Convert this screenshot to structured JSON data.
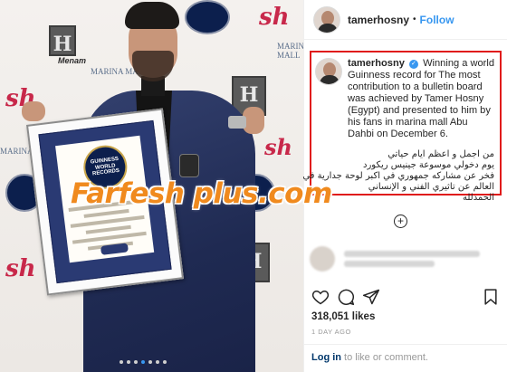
{
  "post": {
    "username": "tamerhosny",
    "separator": "•",
    "follow_label": "Follow",
    "caption_username": "tamerhosny",
    "caption_en": "Winning a world Guinness record for The most contribution to a bulletin board was achieved by Tamer Hosny (Egypt) and presented to him by his fans in marina mall Abu Dahbi on December 6.",
    "caption_ar": [
      "من اجمل و اعظم ايام حياتي",
      "يوم دخولي موسوعة جينيس ريكورد",
      "فخر عن مشاركه جمهوري في اكبر لوحة جدارية في",
      "العالم عن تاثيري الفني و الإنساني",
      "الحمدلله"
    ],
    "likes": "318,051 likes",
    "time_ago": "1 DAY AGO",
    "footer_link": "Log in",
    "footer_rest": " to like or comment."
  },
  "photo": {
    "watermark": "Farfesh plus.com",
    "logos": {
      "sh": "sh",
      "menam": "Menam",
      "marina_mall": "MARINA MALL",
      "world_records": "GUINNESS WORLD RECORDS",
      "cert_seal": "GUINNESS WORLD RECORDS"
    },
    "carousel_dots": 7,
    "active_dot": 3
  },
  "icons": {
    "verified": "verified-badge-icon",
    "heart": "heart-icon",
    "comment": "comment-icon",
    "share": "share-icon",
    "save": "bookmark-icon",
    "add": "plus-circle-icon"
  },
  "colors": {
    "link_blue": "#3897f0",
    "highlight_red": "#e01b1b",
    "watermark_orange": "#f08a1e",
    "jacket_navy": "#2a3566"
  }
}
